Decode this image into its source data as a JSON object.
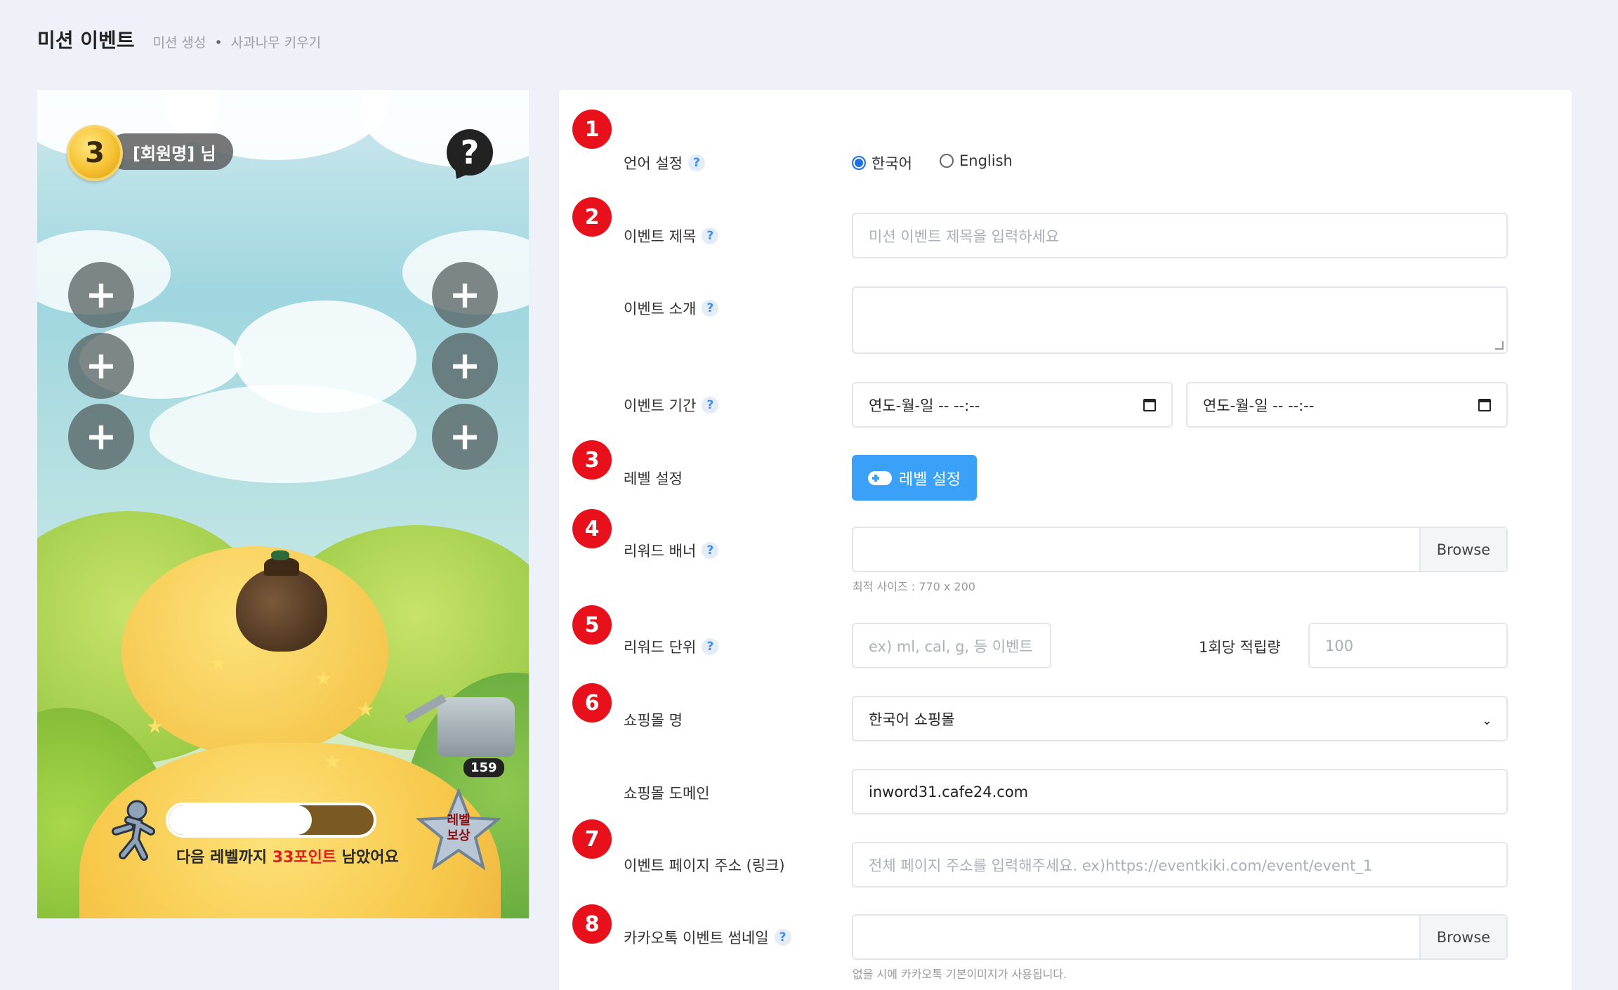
{
  "header": {
    "title": "미션 이벤트",
    "crumb1": "미션 생성",
    "separator": "•",
    "crumb2": "사과나무 키우기"
  },
  "game": {
    "level": "3",
    "member_label": "[회원명] 님",
    "help_glyph": "?",
    "plus_glyph": "+",
    "water_count": "159",
    "progress_fraction": 0.7,
    "progress_text_before": "다음 레벨까지 ",
    "progress_points": "33포인트",
    "progress_text_after": " 남았어요",
    "reward_line1": "레벨",
    "reward_line2": "보상"
  },
  "form": {
    "help_glyph": "?",
    "steps": [
      "1",
      "2",
      "3",
      "4",
      "5",
      "6",
      "7",
      "8"
    ],
    "language": {
      "label": "언어 설정",
      "options": [
        "한국어",
        "English"
      ],
      "selected": "한국어"
    },
    "title": {
      "label": "이벤트 제목",
      "placeholder": "미션 이벤트 제목을 입력하세요"
    },
    "intro": {
      "label": "이벤트 소개",
      "value": ""
    },
    "period": {
      "label": "이벤트 기간",
      "start": "연도-월-일 -- --:--",
      "end": "연도-월-일 -- --:--"
    },
    "level": {
      "label": "레벨 설정",
      "button": "레벨 설정"
    },
    "banner": {
      "label": "리워드 배너",
      "browse": "Browse",
      "hint": "최적 사이즈 : 770 x 200"
    },
    "unit": {
      "label": "리워드 단위",
      "placeholder": "ex) ml, cal, g, 등 이벤트",
      "per_label": "1회당 적립량",
      "per_placeholder": "100"
    },
    "mall": {
      "label": "쇼핑몰 명",
      "selected": "한국어 쇼핑몰"
    },
    "domain": {
      "label": "쇼핑몰 도메인",
      "value": "inword31.cafe24.com"
    },
    "page_url": {
      "label": "이벤트 페이지 주소 (링크)",
      "placeholder": "전체 페이지 주소를 입력해주세요. ex)https://eventkiki.com/event/event_1"
    },
    "kakao": {
      "label": "카카오톡 이벤트 썸네일",
      "browse": "Browse",
      "hint": "없을 시에 카카오톡 기본이미지가 사용됩니다."
    }
  }
}
